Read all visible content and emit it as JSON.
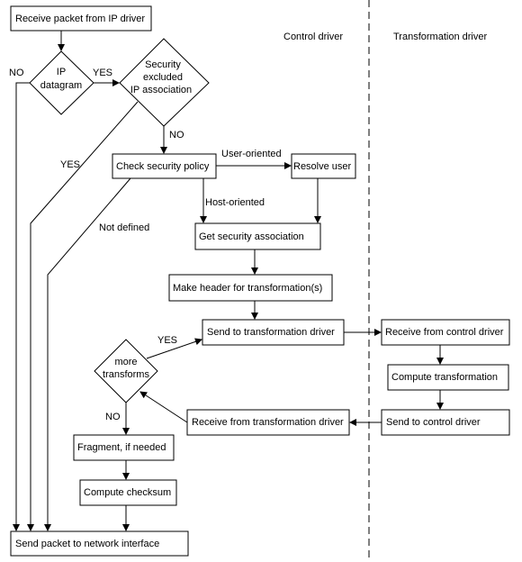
{
  "lanes": {
    "control": "Control driver",
    "transformation": "Transformation driver"
  },
  "nodes": {
    "receive_packet": "Receive packet from IP driver",
    "ip_datagram": [
      "IP",
      "datagram"
    ],
    "security_excluded": [
      "Security",
      "excluded",
      "IP association"
    ],
    "check_policy": "Check security policy",
    "resolve_user": "Resolve user",
    "get_sa": "Get security association",
    "make_header": "Make header for transformation(s)",
    "send_to_transform": "Send to transformation driver",
    "more_transforms": [
      "more",
      "transforms"
    ],
    "receive_from_transform": "Receive from transformation driver",
    "fragment": "Fragment, if needed",
    "checksum": "Compute  checksum",
    "send_packet": "Send packet to network interface",
    "receive_from_control": "Receive from control driver",
    "compute_transformation": "Compute  transformation",
    "send_to_control": "Send to control driver"
  },
  "edge_labels": {
    "no_ip": "NO",
    "yes_ip": "YES",
    "yes_excluded": "YES",
    "no_excluded": "NO",
    "user_oriented": "User-oriented",
    "host_oriented": "Host-oriented",
    "not_defined": "Not defined",
    "yes_more": "YES",
    "no_more": "NO"
  }
}
